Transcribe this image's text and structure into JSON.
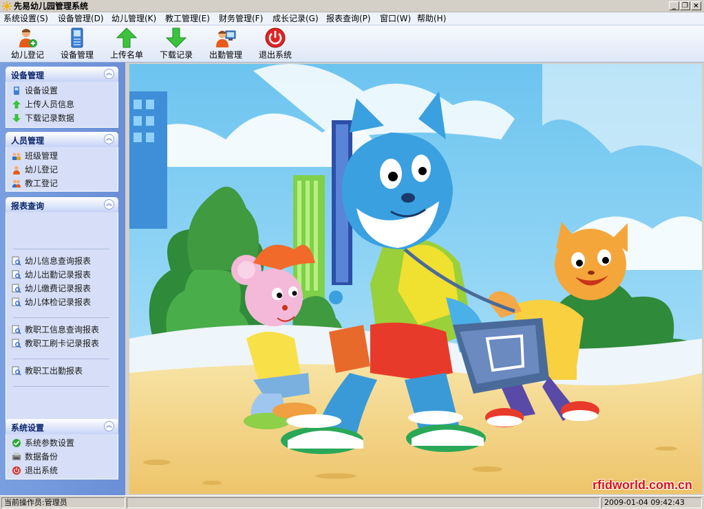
{
  "window": {
    "title": "先易幼儿园管理系统",
    "buttons": {
      "minimize": "_",
      "restore": "❐",
      "close": "×"
    }
  },
  "menu": [
    {
      "label": "系统设置(S)"
    },
    {
      "label": "设备管理(D)"
    },
    {
      "label": "幼儿管理(K)"
    },
    {
      "label": "教工管理(E)"
    },
    {
      "label": "财务管理(F)"
    },
    {
      "label": "成长记录(G)"
    },
    {
      "label": "报表查询(P)"
    },
    {
      "label": "窗口(W)"
    },
    {
      "label": "帮助(H)"
    }
  ],
  "toolbar": [
    {
      "label": "幼儿登记",
      "icon": "child-add-icon"
    },
    {
      "label": "设备管理",
      "icon": "device-icon"
    },
    {
      "label": "上传名单",
      "icon": "upload-arrow-icon"
    },
    {
      "label": "下载记录",
      "icon": "download-arrow-icon"
    },
    {
      "label": "出勤管理",
      "icon": "attendance-icon"
    },
    {
      "label": "退出系统",
      "icon": "power-icon"
    }
  ],
  "sidebar": {
    "device": {
      "title": "设备管理",
      "items": [
        {
          "label": "设备设置",
          "icon": "device-settings-icon"
        },
        {
          "label": "上传人员信息",
          "icon": "upload-arrow-icon"
        },
        {
          "label": "下载记录数据",
          "icon": "download-arrow-icon"
        }
      ]
    },
    "people": {
      "title": "人员管理",
      "items": [
        {
          "label": "班级管理",
          "icon": "class-group-icon"
        },
        {
          "label": "幼儿登记",
          "icon": "child-icon"
        },
        {
          "label": "教工登记",
          "icon": "staff-icon"
        }
      ]
    },
    "reports": {
      "title": "报表查询",
      "items": [
        {
          "label": "幼儿信息查询报表",
          "icon": "report-search-icon"
        },
        {
          "label": "幼儿出勤记录报表",
          "icon": "report-search-icon"
        },
        {
          "label": "幼儿缴费记录报表",
          "icon": "report-search-icon"
        },
        {
          "label": "幼儿体检记录报表",
          "icon": "report-search-icon"
        },
        {
          "label": "教职工信息查询报表",
          "icon": "report-search-icon"
        },
        {
          "label": "教职工刷卡记录报表",
          "icon": "report-search-icon"
        },
        {
          "label": "教职工出勤报表",
          "icon": "report-search-icon"
        }
      ]
    },
    "system": {
      "title": "系统设置",
      "items": [
        {
          "label": "系统参数设置",
          "icon": "checkmark-settings-icon"
        },
        {
          "label": "数据备份",
          "icon": "backup-icon"
        },
        {
          "label": "退出系统",
          "icon": "power-icon"
        }
      ]
    }
  },
  "main": {
    "watermark": "rfidworld.com.cn"
  },
  "status": {
    "operator": "当前操作员:管理员",
    "datetime": "2009-01-04 09:42:43"
  },
  "colors": {
    "nav_bg": "#6b8fd6",
    "section_body": "#d6dff7",
    "sky": "#7ccdf2",
    "sand": "#f5d88a"
  }
}
